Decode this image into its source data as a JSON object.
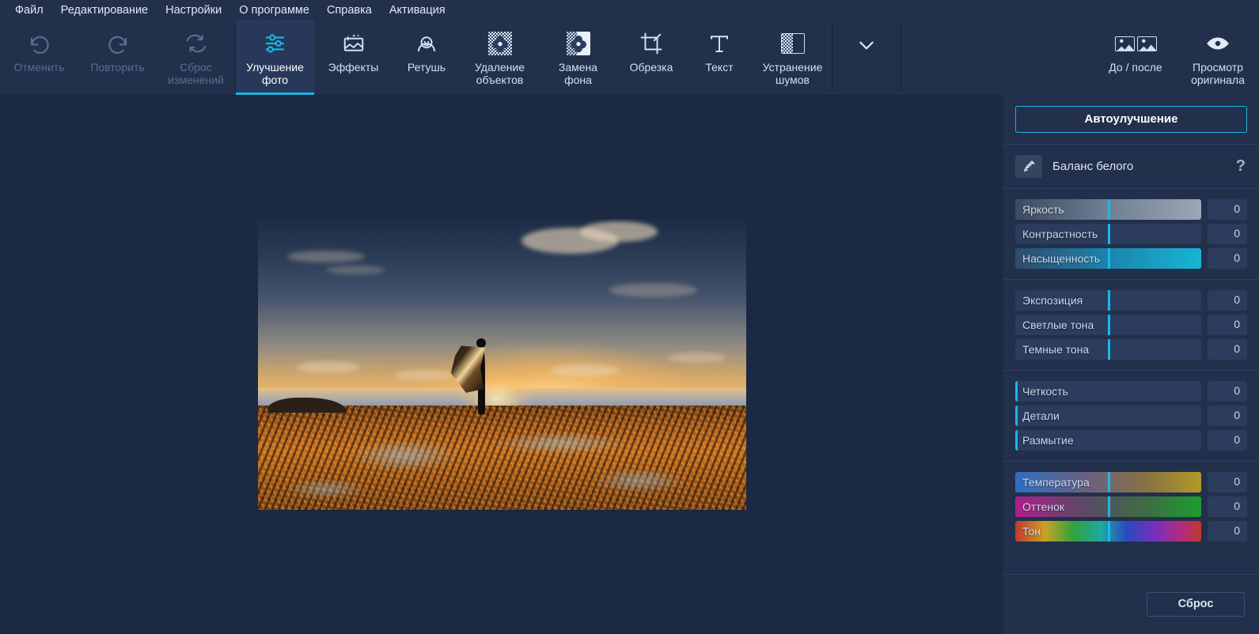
{
  "menu": {
    "items": [
      {
        "label": "Файл",
        "name": "menu-file"
      },
      {
        "label": "Редактирование",
        "name": "menu-edit"
      },
      {
        "label": "Настройки",
        "name": "menu-settings"
      },
      {
        "label": "О программе",
        "name": "menu-about"
      },
      {
        "label": "Справка",
        "name": "menu-help"
      },
      {
        "label": "Активация",
        "name": "menu-activation"
      }
    ]
  },
  "toolbar": {
    "history": [
      {
        "label": "Отменить",
        "icon": "undo-icon",
        "enabled": false
      },
      {
        "label": "Повторить",
        "icon": "redo-icon",
        "enabled": false
      },
      {
        "label": "Сброс\nизменений",
        "icon": "reset-changes-icon",
        "enabled": false
      }
    ],
    "tools": [
      {
        "label": "Улучшение\nфото",
        "icon": "sliders-icon",
        "active": true
      },
      {
        "label": "Эффекты",
        "icon": "effects-icon",
        "active": false
      },
      {
        "label": "Ретушь",
        "icon": "retouch-face-icon",
        "active": false
      },
      {
        "label": "Удаление\nобъектов",
        "icon": "object-removal-icon",
        "active": false
      },
      {
        "label": "Замена\nфона",
        "icon": "background-change-icon",
        "active": false
      },
      {
        "label": "Обрезка",
        "icon": "crop-icon",
        "active": false
      },
      {
        "label": "Текст",
        "icon": "text-icon",
        "active": false
      },
      {
        "label": "Устранение\nшумов",
        "icon": "noise-removal-icon",
        "active": false
      }
    ],
    "more": {
      "label": "Ещё",
      "icon": "chevron-down-icon"
    },
    "view": [
      {
        "label": "До / после",
        "icon": "before-after-icon"
      },
      {
        "label": "Просмотр\nоригинала",
        "icon": "eye-icon"
      }
    ]
  },
  "panel": {
    "auto_enhance_label": "Автоулучшение",
    "white_balance": {
      "label": "Баланс белого",
      "icon": "eyedropper-icon",
      "help": "?"
    },
    "reset_label": "Сброс",
    "slider_groups": [
      {
        "sliders": [
          {
            "label": "Яркость",
            "value": "0",
            "handle_pct": 50,
            "style": "brightness"
          },
          {
            "label": "Контрастность",
            "value": "0",
            "handle_pct": 50,
            "style": "plain"
          },
          {
            "label": "Насыщенность",
            "value": "0",
            "handle_pct": 50,
            "style": "saturation"
          }
        ]
      },
      {
        "sliders": [
          {
            "label": "Экспозиция",
            "value": "0",
            "handle_pct": 50,
            "style": "plain"
          },
          {
            "label": "Светлые тона",
            "value": "0",
            "handle_pct": 50,
            "style": "plain"
          },
          {
            "label": "Темные тона",
            "value": "0",
            "handle_pct": 50,
            "style": "plain"
          }
        ]
      },
      {
        "sliders": [
          {
            "label": "Четкость",
            "value": "0",
            "handle_pct": 0,
            "style": "plain"
          },
          {
            "label": "Детали",
            "value": "0",
            "handle_pct": 0,
            "style": "plain"
          },
          {
            "label": "Размытие",
            "value": "0",
            "handle_pct": 0,
            "style": "plain"
          }
        ]
      },
      {
        "sliders": [
          {
            "label": "Температура",
            "value": "0",
            "handle_pct": 50,
            "style": "temperature"
          },
          {
            "label": "Оттенок",
            "value": "0",
            "handle_pct": 50,
            "style": "tint"
          },
          {
            "label": "Тон",
            "value": "0",
            "handle_pct": 50,
            "style": "hue"
          }
        ]
      }
    ]
  },
  "canvas": {
    "photo_alt": "sunset-beach-photo"
  },
  "colors": {
    "accent": "#1ab4e0",
    "panel_bg": "#22304c",
    "canvas_bg": "#1b2942",
    "text": "#dbe6f3"
  }
}
